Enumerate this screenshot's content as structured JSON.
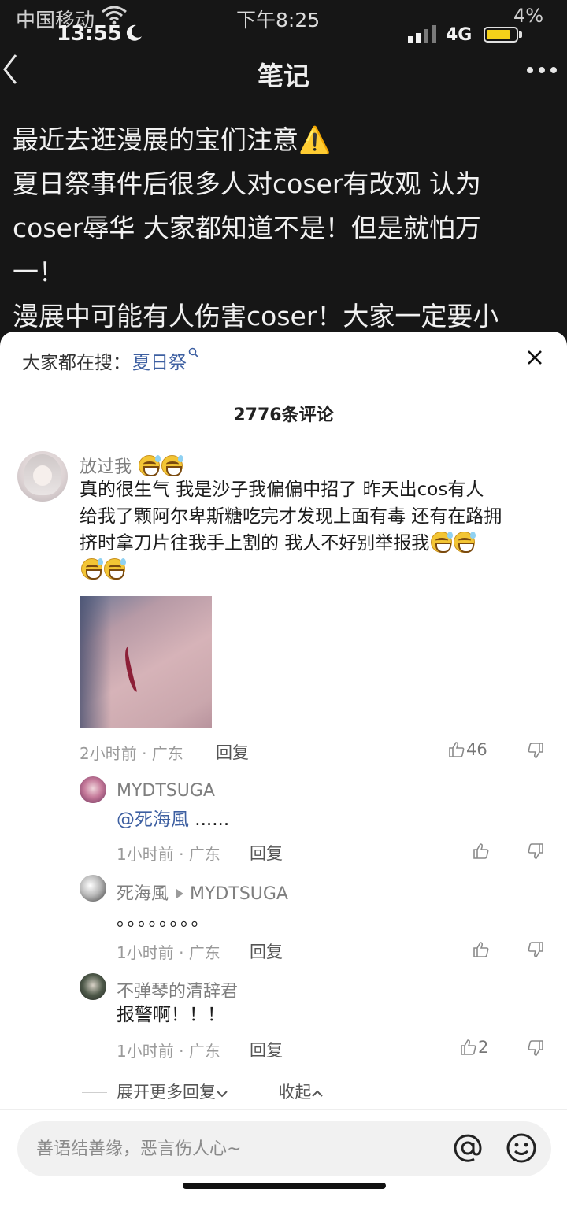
{
  "status_bar": {
    "carrier": "中国移动",
    "time_small": "13:55",
    "time_center": "下午8:25",
    "battery_percent": "4%",
    "network": "4G"
  },
  "nav": {
    "title": "笔记",
    "back_icon": "chevron-left-icon",
    "more_icon": "ellipsis-icon"
  },
  "note": {
    "lines": [
      "最近去逛漫展的宝们注意⚠️",
      "夏日祭事件后很多人对coser有改观 认为",
      "coser辱华 大家都知道不是！但是就怕万",
      "一！",
      "漫展中可能有人伤害coser！大家一定要小"
    ]
  },
  "sheet": {
    "search_label": "大家都在搜：",
    "search_keyword": "夏日祭",
    "close_icon": "close-icon",
    "comment_count": "2776条评论"
  },
  "comments": {
    "main": {
      "username": "放过我",
      "text_lines": [
        "真的很生气 我是沙子我偏偏中招了 昨天出cos有人",
        "给我了颗阿尔卑斯糖吃完才发现上面有毒 还有在路拥",
        "挤时拿刀片往我手上割的 我人不好别举报我"
      ],
      "meta": "2小时前 · 广东",
      "reply_label": "回复",
      "likes": "46"
    },
    "replies": [
      {
        "username": "MYDTSUGA",
        "reply_to": "",
        "mention": "@死海風",
        "text": " ......",
        "meta": "1小时前 · 广东",
        "reply_label": "回复",
        "likes": ""
      },
      {
        "username": "死海風",
        "reply_to": "MYDTSUGA",
        "mention": "",
        "text": "。。。。。。。。",
        "meta": "1小时前 · 广东",
        "reply_label": "回复",
        "likes": ""
      },
      {
        "username": "不弹琴的清辞君",
        "reply_to": "",
        "mention": "",
        "text": "报警啊！！！",
        "meta": "1小时前 · 广东",
        "reply_label": "回复",
        "likes": "2"
      }
    ],
    "expand_more": "展开更多回复",
    "collapse": "收起"
  },
  "input": {
    "placeholder": "善语结善缘，恶言伤人心~",
    "at_icon": "at-icon",
    "emoji_icon": "emoji-icon"
  },
  "colors": {
    "link_blue": "#3d5fa1",
    "top_background": "#161616",
    "sheet_background": "#ffffff",
    "battery_yellow": "#f4d11a"
  }
}
